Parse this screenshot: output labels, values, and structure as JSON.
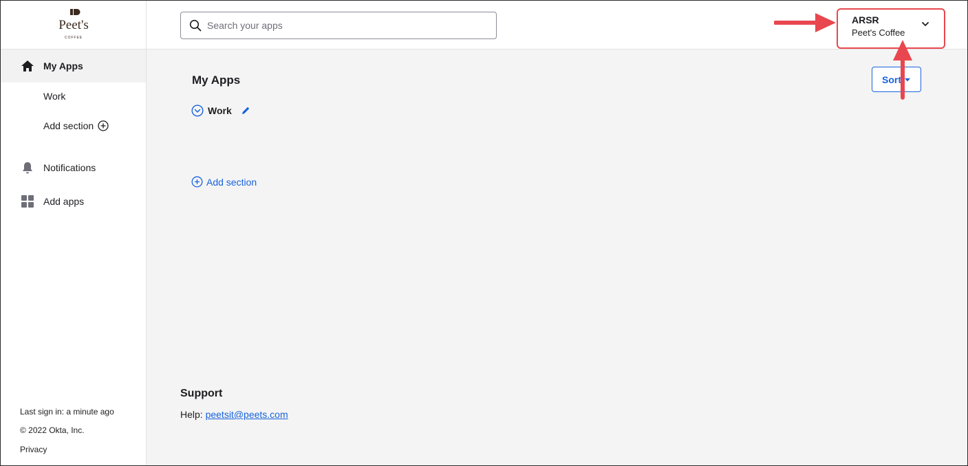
{
  "logo": {
    "text": "Peet's",
    "subtext": "COFFEE"
  },
  "sidebar": {
    "items": [
      {
        "label": "My Apps",
        "icon": "home-icon"
      },
      {
        "label": "Work"
      },
      {
        "label": "Add section",
        "icon": "plus-circle-icon"
      },
      {
        "label": "Notifications",
        "icon": "bell-icon"
      },
      {
        "label": "Add apps",
        "icon": "grid-icon"
      }
    ],
    "footer": {
      "last_sign_in": "Last sign in: a minute ago",
      "copyright": "© 2022 Okta, Inc.",
      "privacy": "Privacy"
    }
  },
  "search": {
    "placeholder": "Search your apps",
    "value": ""
  },
  "user": {
    "name": "ARSR",
    "org": "Peet's Coffee"
  },
  "main": {
    "title": "My Apps",
    "sort_label": "Sort",
    "section_name": "Work",
    "add_section_label": "Add section"
  },
  "support": {
    "title": "Support",
    "help_label": "Help:",
    "help_email": "peetsit@peets.com"
  },
  "colors": {
    "accent": "#1662dd",
    "annotation": "#e8474f",
    "main_bg": "#f4f4f4"
  }
}
